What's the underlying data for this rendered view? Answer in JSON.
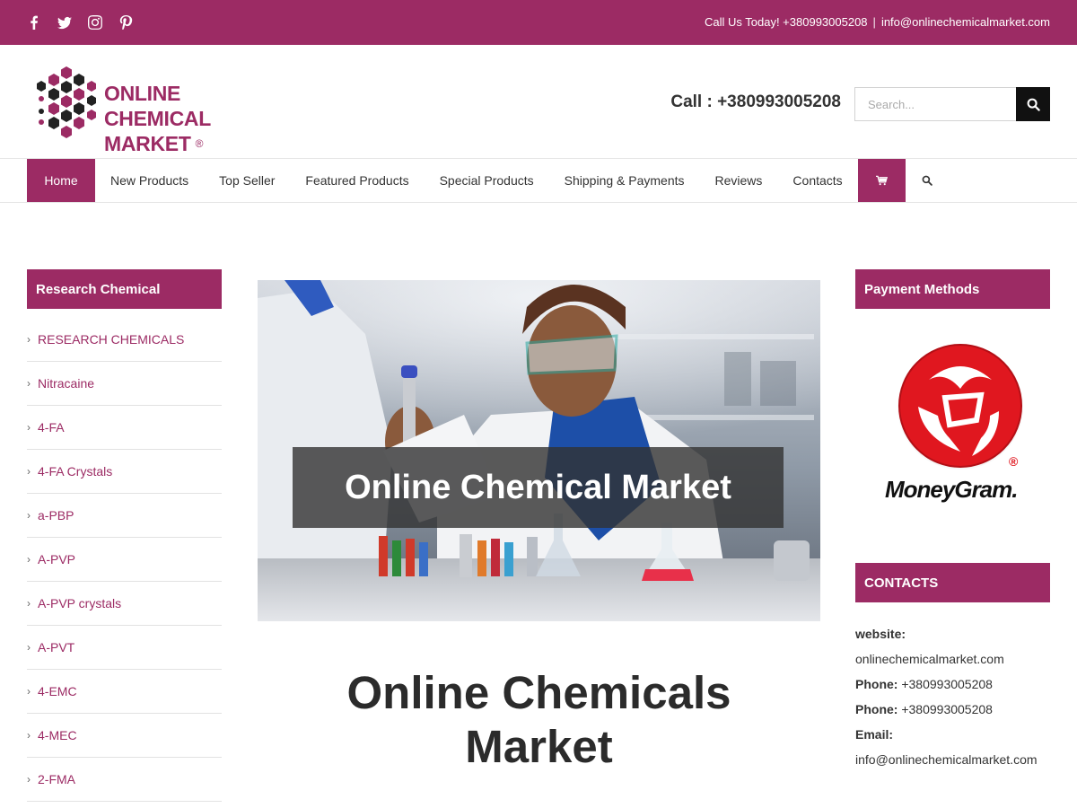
{
  "topbar": {
    "social_icons": [
      "facebook-icon",
      "twitter-icon",
      "instagram-icon",
      "pinterest-icon"
    ],
    "call_text": "Call Us Today! +380993005208",
    "separator": "|",
    "email": "info@onlinechemicalmarket.com"
  },
  "header": {
    "logo_line1": "ONLINE CHEMICAL",
    "logo_line2": "MARKET",
    "logo_reg": "®",
    "call_label": "Call : +380993005208",
    "search_placeholder": "Search..."
  },
  "nav": {
    "items": [
      "Home",
      "New Products",
      "Top Seller",
      "Featured Products",
      "Special Products",
      "Shipping & Payments",
      "Reviews",
      "Contacts"
    ],
    "active": "Home"
  },
  "left_sidebar": {
    "title": "Research Chemical",
    "items": [
      "RESEARCH CHEMICALS",
      "Nitracaine",
      "4-FA",
      "4-FA Crystals",
      "a-PBP",
      "A-PVP",
      "A-PVP crystals",
      "A-PVT",
      "4-EMC",
      "4-MEC",
      "2-FMA"
    ]
  },
  "hero": {
    "overlay_text": "Online Chemical Market"
  },
  "main": {
    "title_line1": "Online Chemicals",
    "title_line2": "Market"
  },
  "right_sidebar": {
    "payment_title": "Payment Methods",
    "moneygram_text": "MoneyGram.",
    "contacts_title": "CONTACTS",
    "website_label": "website:",
    "website_value": "onlinechemicalmarket.com",
    "phone_label": "Phone:",
    "phone1": "+380993005208",
    "phone2": "+380993005208",
    "email_label": "Email:",
    "email_value": "info@onlinechemicalmarket.com"
  },
  "colors": {
    "brand": "#9c2b64",
    "dark": "#333333",
    "moneygram_red": "#e0171f"
  }
}
